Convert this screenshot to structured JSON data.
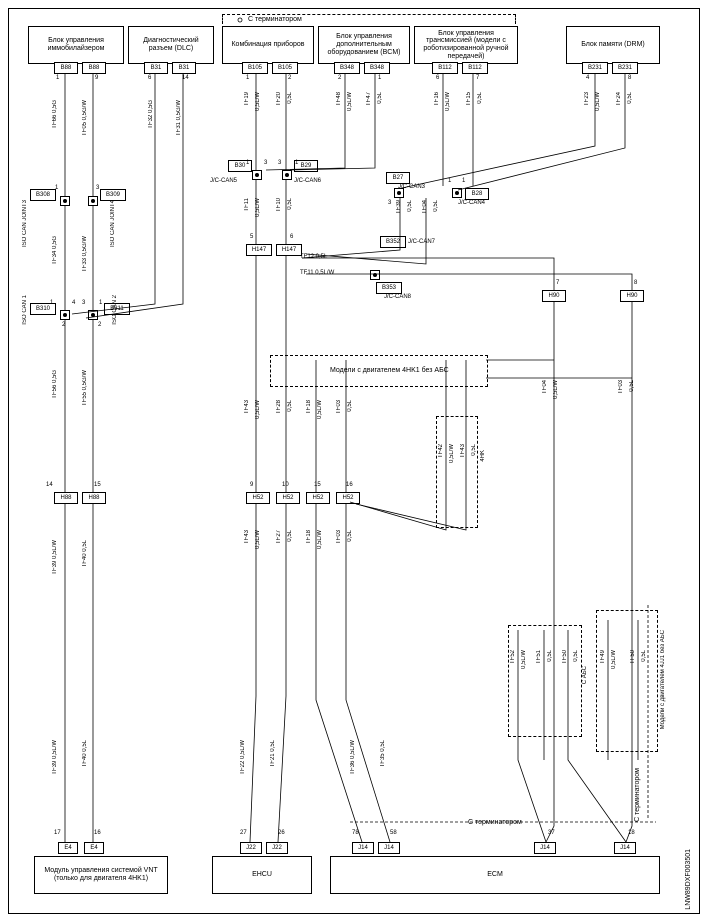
{
  "terminator_top": "С терминатором",
  "terminator_bottom": "С терминатором",
  "terminator_right": "С терминатором",
  "blocks": {
    "immob": "Блок управления иммобилайзером",
    "diag": "Диагностический разъем (DLC)",
    "combi": "Комбинация приборов",
    "bcm": "Блок управления дополнительным оборудованием (BCM)",
    "trans": "Блок управления трансмиссией (модели с роботизированной ручной передачей)",
    "drm": "Блок памяти (DRM)",
    "vnt": "Модуль управления системой VNT (только для двигателя 4HK1)",
    "ehcu": "EHCU",
    "ecm": "ECM"
  },
  "module_boxes": {
    "abs_note": "Модели с двигателем 4HK1 без АБС",
    "4hk": "4HK",
    "cabs": "C АБС",
    "4jj1": "Модели с двигателем 4JJ1 без АБС"
  },
  "pins": {
    "B88a": "B88",
    "B88b": "B88",
    "B31a": "B31",
    "B31b": "B31",
    "B105a": "B105",
    "B105b": "B105",
    "B348a": "B348",
    "B348b": "B348",
    "B112a": "B112",
    "B112b": "B112",
    "B231a": "B231",
    "B231b": "B231",
    "B308": "B308",
    "B309": "B309",
    "B30": "B30",
    "B29": "B29",
    "B27": "B27",
    "B28": "B28",
    "B310": "B310",
    "B311": "B311",
    "B352": "B352",
    "B353": "B353",
    "H147a": "H147",
    "H147b": "H147",
    "H90a": "H90",
    "H90b": "H90",
    "H88a": "H88",
    "H88b": "H88",
    "H52a": "H52",
    "H52b": "H52",
    "H52c": "H52",
    "H52d": "H52",
    "E4a": "E4",
    "E4b": "E4",
    "J22a": "J22",
    "J22b": "J22",
    "J14a": "J14",
    "J14b": "J14",
    "J14c": "J14",
    "J14d": "J14"
  },
  "joints": {
    "j3": "ISO CAN JOINT3",
    "j4": "ISO CAN JOINT4",
    "c1": "ISO CAN 1",
    "c2": "ISO CAN 2",
    "can5": "J/C-CAN5",
    "can6": "J/C-CAN6",
    "can3": "J/C-CAN3",
    "can4": "J/C-CAN4",
    "can7": "J/C-CAN7",
    "can8": "J/C-CAN8"
  },
  "wires": {
    "w1": "TF66 0,5G",
    "w2": "TF05 0,5G/W",
    "w3": "TF32 0,5G",
    "w4": "TF31 0,5G/W",
    "w5a": "TF19",
    "w5b": "0,5L/W",
    "w6a": "TF20",
    "w6b": "0,5L",
    "w7a": "TF48",
    "w7b": "0,5L/W",
    "w8a": "TF47",
    "w8b": "0,5L",
    "w9a": "TF16",
    "w9b": "0,5L/W",
    "w10a": "TF15",
    "w10b": "0,5L",
    "w11a": "TF23",
    "w11b": "0,5L/W",
    "w12a": "TF24",
    "w12b": "0,5L",
    "w13a": "TF11",
    "w13b": "0,5L/W",
    "w14a": "TF10",
    "w14b": "0,5L",
    "w15": "TF12 0,5L",
    "w16": "TF11 0,5L/W",
    "w17": "TF34 0,5G",
    "w18": "TF33 0,5G/W",
    "w19": "TF56 0,5G",
    "w20": "TF55 0,5G/W",
    "w21a": "TF43",
    "w21b": "0,5L/W",
    "w22a": "TF28",
    "w22b": "0,5L",
    "w23a": "TF18",
    "w23b": "0,5L/W",
    "w24a": "TF03",
    "w24b": "0,5L",
    "w25a": "TF42",
    "w25b": "0,5L/W",
    "w26a": "TF43",
    "w26b": "0,5L",
    "w27a": "TF39",
    "w27b": "0,5L",
    "w28a": "TF04",
    "w28b": "0,5L",
    "w29a": "TF04",
    "w29b": "0,5L/W",
    "w30a": "TF03",
    "w30b": "0,5L",
    "w31": "TF39 0,5L/W",
    "w32": "TF40 0,5L",
    "w33a": "TF43",
    "w33b": "0,5L/W",
    "w34a": "TF27",
    "w34b": "0,5L",
    "w35a": "TF18",
    "w35b": "0,5L/W",
    "w36a": "TF03",
    "w36b": "0,5L",
    "w37": "TF22 0,5L/W",
    "w38": "TF21 0,5L",
    "w39": "TF36 0,5L/W",
    "w40": "TF35 0,5L",
    "w41a": "TF52",
    "w41b": "0,5L/W",
    "w42a": "TF51",
    "w42b": "0,5L",
    "w43a": "TF50",
    "w43b": "0,5L",
    "w44a": "TF49",
    "w44b": "0,5L/W",
    "w45a": "TF50",
    "w45b": "0,5L"
  },
  "nums": {
    "n1": "1",
    "n2": "2",
    "n3": "3",
    "n4": "4",
    "n5": "5",
    "n6": "6",
    "n7": "7",
    "n8": "8",
    "n9": "9",
    "n10": "10",
    "n11": "11",
    "n14": "14",
    "n15": "15",
    "n16": "16",
    "n17": "17",
    "n18": "18",
    "n26": "26",
    "n27": "27",
    "n37": "37",
    "n58": "58",
    "n78": "78"
  },
  "docid": "LNW89DXF003501"
}
